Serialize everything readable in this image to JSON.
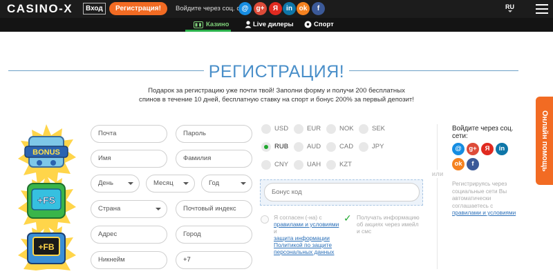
{
  "header": {
    "logo": "CASINO-X",
    "login_label": "Вход",
    "register_label": "Регистрация!",
    "social_label": "Войдите через соц. сети:",
    "social_icons": [
      {
        "name": "mail-ru-icon",
        "glyph": "@",
        "color": "#168de2"
      },
      {
        "name": "google-plus-icon",
        "glyph": "g+",
        "color": "#dd4b39"
      },
      {
        "name": "yandex-icon",
        "glyph": "Я",
        "color": "#e02a20"
      },
      {
        "name": "linkedin-icon",
        "glyph": "in",
        "color": "#0e76a8"
      },
      {
        "name": "odnoklassniki-icon",
        "glyph": "ok",
        "color": "#f58220"
      },
      {
        "name": "facebook-icon",
        "glyph": "f",
        "color": "#3b5998"
      }
    ],
    "language": "RU"
  },
  "nav": {
    "items": [
      {
        "label": "Казино",
        "icon": "slots-icon",
        "active": true
      },
      {
        "label": "Live дилеры",
        "icon": "dealer-icon",
        "active": false
      },
      {
        "label": "Спорт",
        "icon": "soccer-ball-icon",
        "active": false
      }
    ]
  },
  "page": {
    "title": "РЕГИСТРАЦИЯ!",
    "description": "Подарок за регистрацию уже почти твой! Заполни форму и получи 200 бесплатных спинов в течение 10 дней, бесплатную ставку на спорт и бонус 200% за первый депозит!"
  },
  "promo": {
    "badges": [
      "BONUS",
      "+FS",
      "+FB"
    ]
  },
  "form": {
    "email_placeholder": "Почта",
    "password_placeholder": "Пароль",
    "firstname_placeholder": "Имя",
    "lastname_placeholder": "Фамилия",
    "day_placeholder": "День",
    "month_placeholder": "Месяц",
    "year_placeholder": "Год",
    "country_placeholder": "Страна",
    "zip_placeholder": "Почтовый индекс",
    "address_placeholder": "Адрес",
    "city_placeholder": "Город",
    "nickname_placeholder": "Никнейм",
    "phone_value": "+7",
    "currencies": [
      "USD",
      "EUR",
      "NOK",
      "SEK",
      "RUB",
      "AUD",
      "CAD",
      "JPY",
      "CNY",
      "UAH",
      "KZT"
    ],
    "selected_currency": "RUB",
    "or_label": "или",
    "bonus_placeholder": "Бонус код",
    "terms_prefix": "Я согласен (-на) с",
    "terms_link": "правилами и условиями",
    "terms_and": "и",
    "privacy_link": "Политикой по защите персональных данных",
    "privacy_prefix": "защита информации",
    "newsletter_label": "Получать информацию об акциях через имейл и смс"
  },
  "side": {
    "title": "Войдите через соц. сети:",
    "note": "Регистрируясь через социальные сети Вы автоматически соглашаетесь с",
    "note_link": "правилами и условиями"
  },
  "help": {
    "label": "Онлайн помощь"
  },
  "colors": {
    "accent_orange": "#f26b23",
    "title_blue": "#4a8fc9",
    "active_green": "#2bb24c"
  }
}
